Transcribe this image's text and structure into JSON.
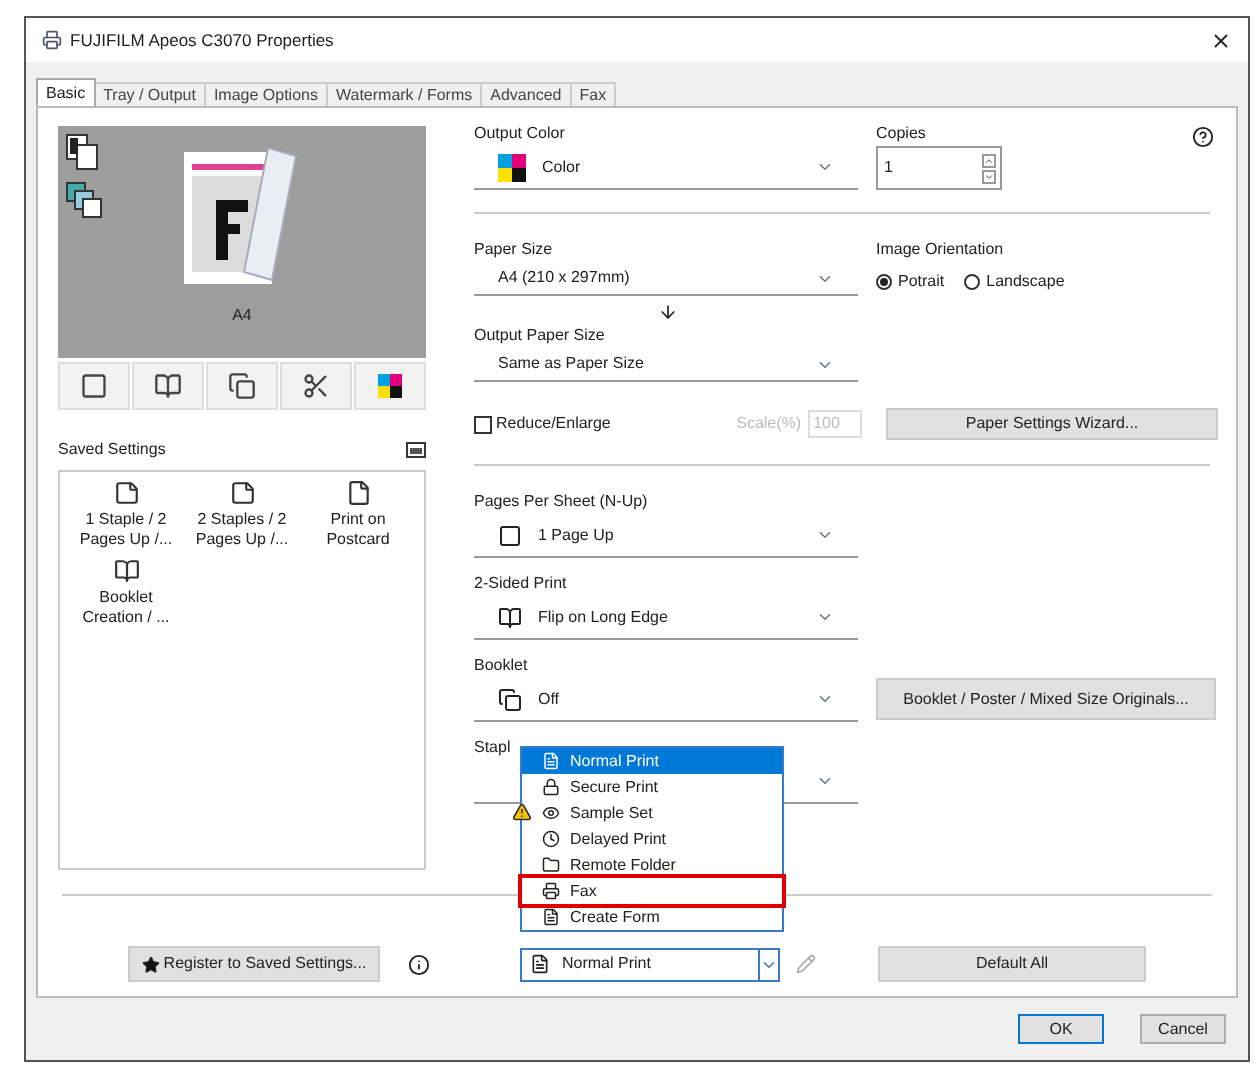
{
  "window": {
    "title": "FUJIFILM Apeos C3070 Properties"
  },
  "tabs": [
    {
      "label": "Basic",
      "selected": true
    },
    {
      "label": "Tray / Output",
      "selected": false
    },
    {
      "label": "Image Options",
      "selected": false
    },
    {
      "label": "Watermark / Forms",
      "selected": false
    },
    {
      "label": "Advanced",
      "selected": false
    },
    {
      "label": "Fax",
      "selected": false
    }
  ],
  "preview": {
    "paper_label": "A4"
  },
  "saved_settings": {
    "title": "Saved Settings",
    "items": [
      {
        "label": "1 Staple / 2 Pages Up /..."
      },
      {
        "label": "2 Staples / 2 Pages Up /..."
      },
      {
        "label": "Print on Postcard"
      },
      {
        "label": "Booklet Creation / ..."
      }
    ]
  },
  "output_color": {
    "label": "Output Color",
    "value": "Color"
  },
  "copies": {
    "label": "Copies",
    "value": "1"
  },
  "paper_size": {
    "label": "Paper Size",
    "value": "A4 (210 x 297mm)"
  },
  "image_orientation": {
    "label": "Image Orientation",
    "options": [
      {
        "label": "Potrait",
        "selected": true
      },
      {
        "label": "Landscape",
        "selected": false
      }
    ]
  },
  "output_paper_size": {
    "label": "Output Paper Size",
    "value": "Same as Paper Size"
  },
  "reduce_enlarge": {
    "label": "Reduce/Enlarge",
    "checked": false
  },
  "scale": {
    "label": "Scale(%)",
    "value": "100",
    "disabled": true
  },
  "paper_settings_button": "Paper Settings Wizard...",
  "pages_per_sheet": {
    "label": "Pages Per Sheet (N-Up)",
    "value": "1 Page Up"
  },
  "two_sided": {
    "label": "2-Sided Print",
    "value": "Flip on Long Edge"
  },
  "booklet": {
    "label": "Booklet",
    "value": "Off"
  },
  "booklet_button": "Booklet / Poster / Mixed Size Originals...",
  "stapling": {
    "label": "Stapl"
  },
  "register_button": "Register to Saved Settings...",
  "job_type": {
    "value": "Normal Print",
    "expanded": true,
    "options": [
      {
        "label": "Normal Print",
        "selected": true,
        "warning": false,
        "highlighted": false
      },
      {
        "label": "Secure Print",
        "selected": false,
        "warning": false,
        "highlighted": false
      },
      {
        "label": "Sample Set",
        "selected": false,
        "warning": true,
        "highlighted": false
      },
      {
        "label": "Delayed Print",
        "selected": false,
        "warning": false,
        "highlighted": false
      },
      {
        "label": "Remote Folder",
        "selected": false,
        "warning": false,
        "highlighted": false
      },
      {
        "label": "Fax",
        "selected": false,
        "warning": false,
        "highlighted": true
      },
      {
        "label": "Create Form",
        "selected": false,
        "warning": false,
        "highlighted": false
      }
    ]
  },
  "default_all_button": "Default All",
  "buttons": [
    "OK",
    "Cancel"
  ]
}
